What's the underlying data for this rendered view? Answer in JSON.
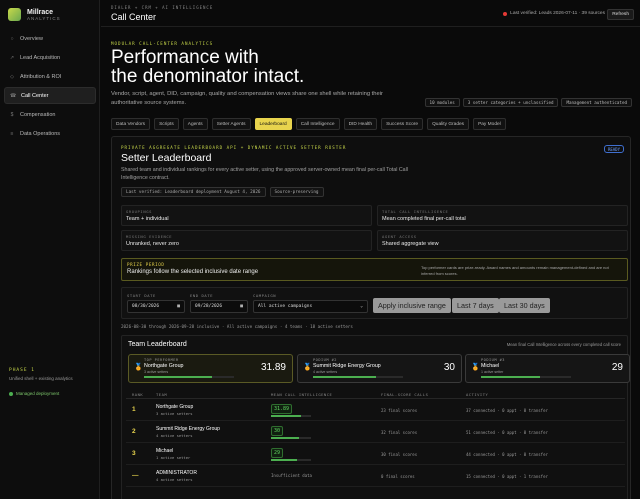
{
  "brand": {
    "name": "Millrace",
    "sub": "ANALYTICS"
  },
  "nav": [
    {
      "label": "Overview",
      "icon": "grid-icon",
      "glyph": "○"
    },
    {
      "label": "Lead Acquisition",
      "icon": "arrow-icon",
      "glyph": "↗"
    },
    {
      "label": "Attribution & ROI",
      "icon": "branch-icon",
      "glyph": "◇"
    },
    {
      "label": "Call Center",
      "icon": "phone-icon",
      "glyph": "☎"
    },
    {
      "label": "Compensation",
      "icon": "dollar-icon",
      "glyph": "$"
    },
    {
      "label": "Data Operations",
      "icon": "database-icon",
      "glyph": "≡"
    }
  ],
  "phase": {
    "label": "PHASE 1",
    "desc": "Unified shell + existing analytics"
  },
  "managed": "Managed deployment",
  "header": {
    "breadcrumb": "DIALER + CRM + AI INTELLIGENCE",
    "title": "Call Center",
    "verified": "Last verified: Leads 2026-07-11 · 39 sources",
    "refresh": "Refresh"
  },
  "hero": {
    "eyebrow": "MODULAR CALL-CENTER ANALYTICS",
    "title_line1": "Performance with",
    "title_line2": "the denominator intact.",
    "desc": "Vendor, script, agent, DID, campaign, quality and compensation views share one shell while retaining their authoritative source systems.",
    "badges": [
      "10 modules",
      "3 setter categories + unclassified",
      "Management authenticated"
    ]
  },
  "tabs": [
    "Data Vendors",
    "Scripts",
    "Agents",
    "Setter Agents",
    "Leaderboard",
    "Call Intelligence",
    "DID Health",
    "Success Score",
    "Quality Grades",
    "Pay Model"
  ],
  "active_tab": 4,
  "panel": {
    "eyebrow": "PRIVATE AGGREGATE LEADERBOARD API + DYNAMIC ACTIVE SETTER ROSTER",
    "status": "READY",
    "title": "Setter Leaderboard",
    "desc": "Shared team and individual rankings for every active setter, using the approved server-owned mean final per-call Total Call Intelligence contract.",
    "chips": [
      "Last verified: Leaderboard deployment August 4, 2026",
      "Source-preserving"
    ],
    "meta": [
      {
        "k": "GROUPINGS",
        "v": "Team + individual"
      },
      {
        "k": "TOTAL CALL INTELLIGENCE",
        "v": "Mean completed final per-call total"
      },
      {
        "k": "MISSING EVIDENCE",
        "v": "Unranked, never zero"
      },
      {
        "k": "AGENT ACCESS",
        "v": "Shared aggregate view"
      }
    ],
    "period": {
      "k": "PRIZE PERIOD",
      "v": "Rankings follow the selected inclusive date range",
      "note": "Top performer cards are prize-ready. Award names and amounts remain management-defined and are not inferred from scores."
    },
    "filters": {
      "start_label": "START DATE",
      "start": "08/30/2026",
      "end_label": "END DATE",
      "end": "09/28/2026",
      "campaign_label": "CAMPAIGN",
      "campaign": "All active campaigns",
      "apply": "Apply inclusive range",
      "last7": "Last 7 days",
      "last30": "Last 30 days"
    },
    "summary": "2026-08-30 through 2026-09-28 inclusive · All active campaigns · 4 teams · 18 active setters"
  },
  "leaderboard": {
    "title": "Team Leaderboard",
    "sub": "Mean final Call Intelligence across every completed call score",
    "cards": [
      {
        "k": "TOP PERFORMER",
        "name": "Northgate Group",
        "sub": "3 active setters",
        "score": "31.89",
        "fill": 0.75
      },
      {
        "k": "PODIUM #2",
        "name": "Summit Ridge Energy Group",
        "sub": "4 active setters",
        "score": "30",
        "fill": 0.7
      },
      {
        "k": "PODIUM #3",
        "name": "Michael",
        "sub": "1 active setter",
        "score": "29",
        "fill": 0.65
      }
    ],
    "headers": [
      "RANK",
      "TEAM",
      "MEAN CALL INTELLIGENCE",
      "FINAL-SCORE CALLS",
      "ACTIVITY"
    ],
    "rows": [
      {
        "rank": "1",
        "name": "Northgate Group",
        "sub": "3 active setters",
        "score": "31.89",
        "fill": 0.75,
        "calls": "23 final scores",
        "activity": "37 connected · 0 appt · 0 transfer"
      },
      {
        "rank": "2",
        "name": "Summit Ridge Energy Group",
        "sub": "4 active setters",
        "score": "30",
        "fill": 0.7,
        "calls": "32 final scores",
        "activity": "51 connected · 0 appt · 0 transfer"
      },
      {
        "rank": "3",
        "name": "Michael",
        "sub": "1 active setter",
        "score": "29",
        "fill": 0.65,
        "calls": "30 final scores",
        "activity": "44 connected · 0 appt · 0 transfer"
      },
      {
        "rank": "—",
        "name": "ADMINISTRATOR",
        "sub": "4 active setters",
        "score": "",
        "insufficient": "Insufficient data",
        "calls": "0 final scores",
        "activity": "15 connected · 0 appt · 1 transfer"
      }
    ]
  }
}
